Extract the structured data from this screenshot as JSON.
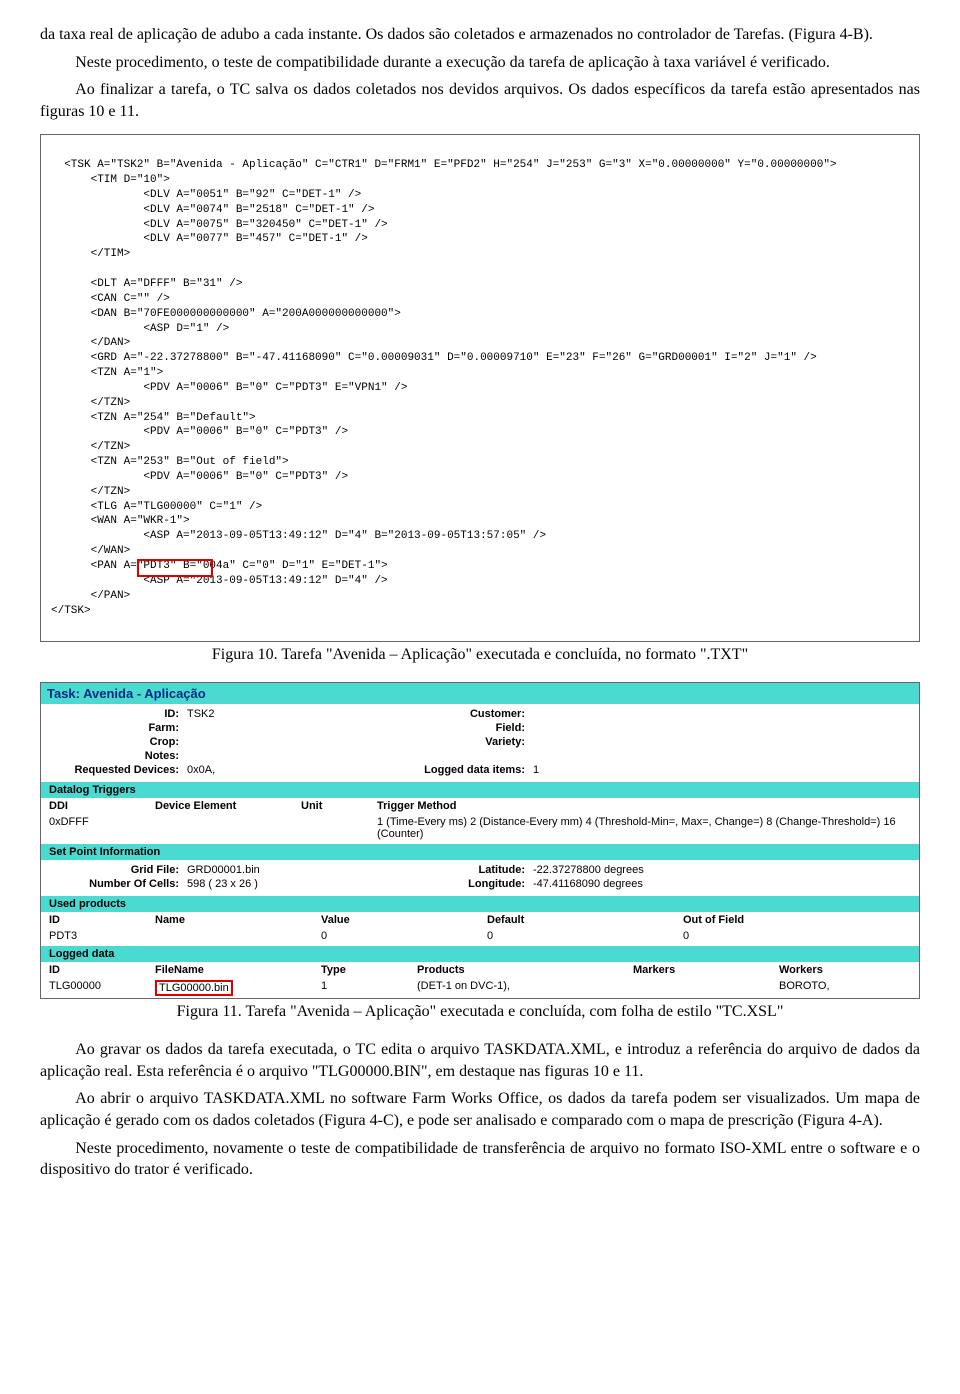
{
  "paragraphs": {
    "p1a": "da taxa real de aplicação de adubo a cada instante. Os dados são coletados e armazenados no controlador de Tarefas. (Figura 4-B).",
    "p1b": "Neste procedimento, o teste de compatibilidade durante a execução da tarefa de aplicação à taxa variável é verificado.",
    "p1c": "Ao finalizar a tarefa, o TC salva os dados coletados nos devidos arquivos. Os dados específicos da tarefa estão apresentados nas figuras 10 e 11.",
    "p2a": "Ao gravar os dados da tarefa executada, o TC edita o arquivo TASKDATA.XML, e introduz a referência do arquivo de dados da aplicação real. Esta referência é o arquivo \"TLG00000.BIN\", em destaque nas figuras 10 e 11.",
    "p2b": "Ao abrir o arquivo TASKDATA.XML no software Farm Works Office, os dados da tarefa podem ser visualizados. Um mapa de aplicação é gerado com os dados coletados (Figura 4-C), e pode ser analisado e comparado com o mapa de prescrição (Figura 4-A).",
    "p2c": "Neste procedimento, novamente o teste de compatibilidade de transferência de arquivo no formato ISO-XML entre o software e o dispositivo do trator é verificado."
  },
  "code_xml": "<TSK A=\"TSK2\" B=\"Avenida - Aplicação\" C=\"CTR1\" D=\"FRM1\" E=\"PFD2\" H=\"254\" J=\"253\" G=\"3\" X=\"0.00000000\" Y=\"0.00000000\">\n      <TIM D=\"10\">\n              <DLV A=\"0051\" B=\"92\" C=\"DET-1\" />\n              <DLV A=\"0074\" B=\"2518\" C=\"DET-1\" />\n              <DLV A=\"0075\" B=\"320450\" C=\"DET-1\" />\n              <DLV A=\"0077\" B=\"457\" C=\"DET-1\" />\n      </TIM>\n\n      <DLT A=\"DFFF\" B=\"31\" />\n      <CAN C=\"\" />\n      <DAN B=\"70FE000000000000\" A=\"200A000000000000\">\n              <ASP D=\"1\" />\n      </DAN>\n      <GRD A=\"-22.37278800\" B=\"-47.41168090\" C=\"0.00009031\" D=\"0.00009710\" E=\"23\" F=\"26\" G=\"GRD00001\" I=\"2\" J=\"1\" />\n      <TZN A=\"1\">\n              <PDV A=\"0006\" B=\"0\" C=\"PDT3\" E=\"VPN1\" />\n      </TZN>\n      <TZN A=\"254\" B=\"Default\">\n              <PDV A=\"0006\" B=\"0\" C=\"PDT3\" />\n      </TZN>\n      <TZN A=\"253\" B=\"Out of field\">\n              <PDV A=\"0006\" B=\"0\" C=\"PDT3\" />\n      </TZN>\n      <TLG A=\"TLG00000\" C=\"1\" />\n      <WAN A=\"WKR-1\">\n              <ASP A=\"2013-09-05T13:49:12\" D=\"4\" B=\"2013-09-05T13:57:05\" />\n      </WAN>\n      <PAN A=\"PDT3\" B=\"004a\" C=\"0\" D=\"1\" E=\"DET-1\">\n              <ASP A=\"2013-09-05T13:49:12\" D=\"4\" />\n      </PAN>\n</TSK>",
  "captions": {
    "fig10": "Figura 10. Tarefa \"Avenida – Aplicação\" executada e concluída, no formato \".TXT\"",
    "fig11": "Figura 11. Tarefa \"Avenida – Aplicação\" executada e concluída, com folha de estilo \"TC.XSL\""
  },
  "panel": {
    "title": "Task: Avenida - Aplicação",
    "rows1": {
      "id_l": "ID:",
      "id_v": "TSK2",
      "cust_l": "Customer:",
      "cust_v": "",
      "farm_l": "Farm:",
      "farm_v": "",
      "field_l": "Field:",
      "field_v": "",
      "crop_l": "Crop:",
      "crop_v": "",
      "variety_l": "Variety:",
      "variety_v": "",
      "notes_l": "Notes:",
      "notes_v": "",
      "rd_l": "Requested Devices:",
      "rd_v": "0x0A,",
      "ldi_l": "Logged data items:",
      "ldi_v": "1"
    },
    "sec_datalog": "Datalog Triggers",
    "datalog_headers": {
      "ddi": "DDI",
      "de": "Device Element",
      "unit": "Unit",
      "tm": "Trigger Method"
    },
    "datalog_row": {
      "ddi": "0xDFFF",
      "de": "",
      "unit": "",
      "tm": "1 (Time-Every ms) 2 (Distance-Every mm) 4 (Threshold-Min=, Max=, Change=) 8 (Change-Threshold=) 16 (Counter)"
    },
    "sec_setpoint": "Set Point Information",
    "setpoint": {
      "gf_l": "Grid File:",
      "gf_v": "GRD00001.bin",
      "lat_l": "Latitude:",
      "lat_v": "-22.37278800 degrees",
      "nc_l": "Number Of Cells:",
      "nc_v": "598 ( 23 x 26 )",
      "lon_l": "Longitude:",
      "lon_v": "-47.41168090 degrees"
    },
    "sec_used": "Used products",
    "used_headers": {
      "id": "ID",
      "name": "Name",
      "value": "Value",
      "def": "Default",
      "oof": "Out of Field"
    },
    "used_row": {
      "id": "PDT3",
      "name": "",
      "value": "0",
      "def": "0",
      "oof": "0"
    },
    "sec_logged": "Logged data",
    "logged_headers": {
      "id": "ID",
      "fn": "FileName",
      "type": "Type",
      "prod": "Products",
      "mk": "Markers",
      "wk": "Workers"
    },
    "logged_row": {
      "id": "TLG00000",
      "fn": "TLG00000.bin",
      "type": "1",
      "prod": "(DET-1 on DVC-1),",
      "mk": "",
      "wk": "BOROTO,"
    }
  }
}
